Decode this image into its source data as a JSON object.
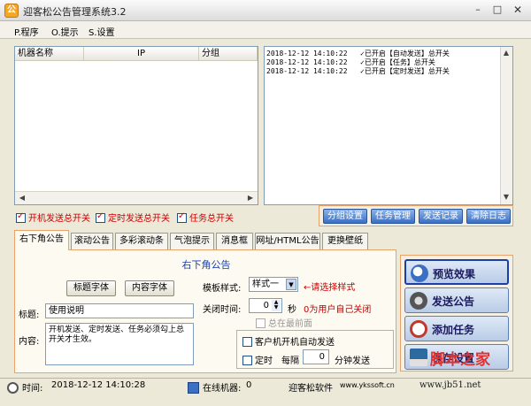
{
  "window": {
    "title": "迎客松公告管理系统3.2",
    "app_icon_glyph": "公",
    "minimize_glyph": "–",
    "maximize_glyph": "□",
    "close_glyph": "✕"
  },
  "menu": [
    "P.程序",
    "O.提示",
    "S.设置"
  ],
  "machine_list": {
    "columns": [
      "机器名称",
      "IP",
      "分组"
    ],
    "rows": []
  },
  "log": [
    {
      "time": "2018-12-12 14:10:22",
      "text": "已开启【自动发送】总开关"
    },
    {
      "time": "2018-12-12 14:10:22",
      "text": "已开启【任务】总开关"
    },
    {
      "time": "2018-12-12 14:10:22",
      "text": "已开启【定时发送】总开关"
    }
  ],
  "switches": [
    {
      "label": "开机发送总开关",
      "checked": true
    },
    {
      "label": "定时发送总开关",
      "checked": true
    },
    {
      "label": "任务总开关",
      "checked": true
    }
  ],
  "log_buttons": [
    "分组设置",
    "任务管理",
    "发送记录",
    "清除日志"
  ],
  "tabs": [
    "右下角公告",
    "滚动公告",
    "多彩滚动条",
    "气泡提示",
    "消息框",
    "网址/HTML公告",
    "更换壁纸"
  ],
  "active_tab": 0,
  "panel": {
    "title": "右下角公告",
    "title_font_button": "标题字体",
    "content_font_button": "内容字体",
    "title_label": "标题:",
    "title_value": "使用说明",
    "content_label": "内容:",
    "content_value": "开机发送、定时发送、任务必须勾上总开关才生效。",
    "template_label": "模板样式:",
    "template_value": "样式一",
    "template_hint": "←请选择样式",
    "close_time_label": "关闭时间:",
    "close_time_value": "0",
    "close_time_unit": "秒",
    "close_time_hint": "0为用户自己关闭",
    "always_on_top_label": "总在最前面",
    "autostart_label": "客户机开机自动发送",
    "timed_label": "定时",
    "every_label": "每隔",
    "interval_value": "0",
    "interval_unit": "分钟发送"
  },
  "actions": [
    {
      "label": "预览效果",
      "icon": "magnifier-icon",
      "color": "#3b6fc4"
    },
    {
      "label": "发送公告",
      "icon": "speaker-icon",
      "color": "#555555"
    },
    {
      "label": "添加任务",
      "icon": "clock-icon",
      "color": "#c0392b"
    },
    {
      "label": "保存设置",
      "icon": "save-icon",
      "color": "#2d6a9f"
    }
  ],
  "status": {
    "time_label": "时间:",
    "time_value": "2018-12-12 14:10:28",
    "online_label": "在线机器:",
    "online_value": "0",
    "software_label": "迎客松软件",
    "website": "www.ykssoft.cn"
  },
  "watermark": {
    "logo": "脚本之家",
    "url": "www.jb51.net"
  }
}
